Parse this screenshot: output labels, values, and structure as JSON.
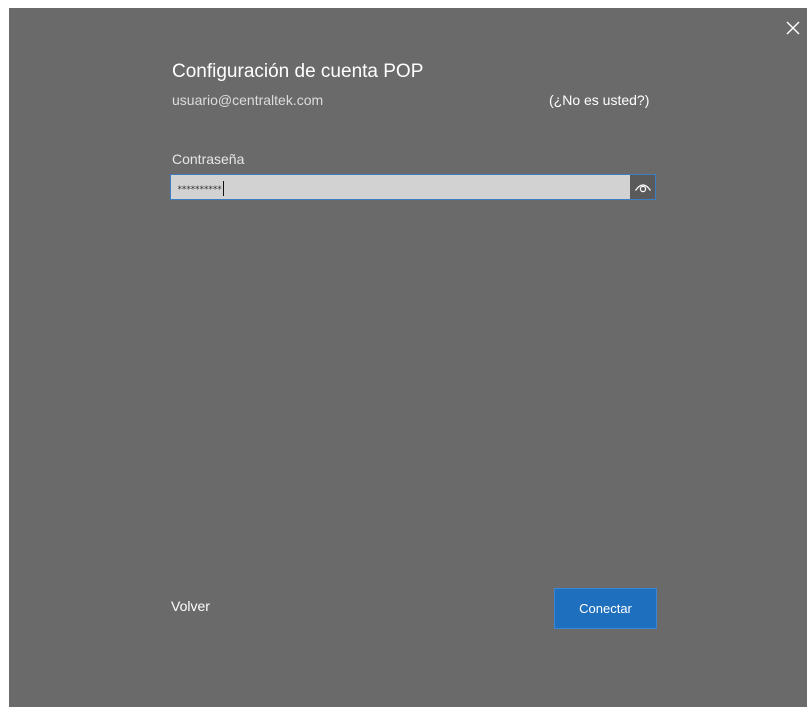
{
  "dialog": {
    "title": "Configuración de cuenta POP",
    "email": "usuario@centraltek.com",
    "not_you_link": "(¿No es usted?)",
    "close_icon": "close-icon"
  },
  "password": {
    "label": "Contraseña",
    "masked_value": "**********",
    "reveal_icon": "eye-icon"
  },
  "footer": {
    "back_label": "Volver",
    "connect_label": "Conectar"
  },
  "colors": {
    "dialog_bg": "#6a6a6a",
    "input_bg": "#d2d2d2",
    "input_border": "#3d7dc2",
    "primary_button": "#1f6fbf"
  }
}
